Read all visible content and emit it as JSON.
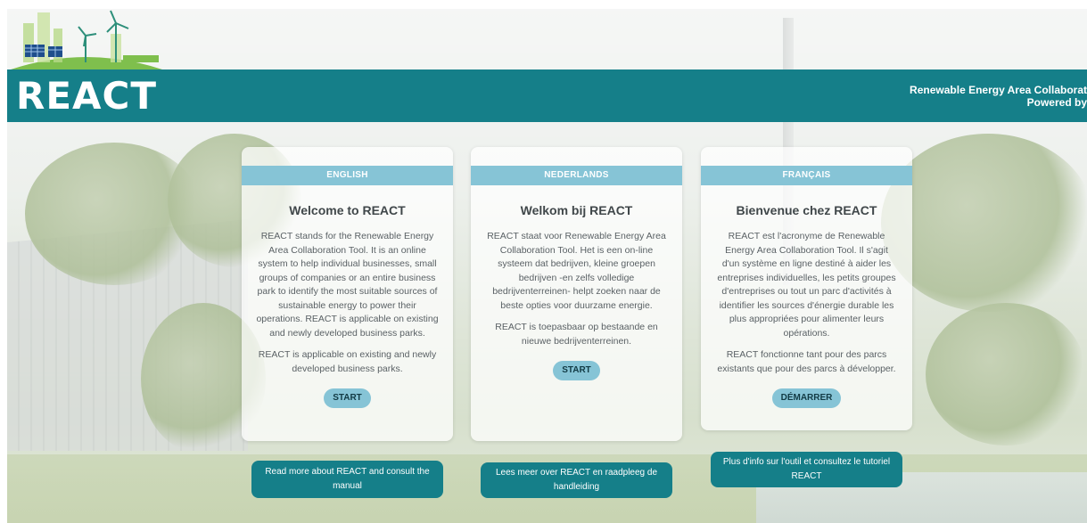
{
  "header": {
    "brand": "REACT",
    "tagline_line1": "Renewable Energy Area Collaborat",
    "tagline_line2": "Powered by"
  },
  "cards": [
    {
      "language": "ENGLISH",
      "title": "Welcome to REACT",
      "paragraphs": [
        "REACT stands for the Renewable Energy Area Collaboration Tool. It is an online system to help individual businesses, small groups of companies or an entire business park to identify the most suitable sources of sustainable energy to power their operations. REACT is applicable on existing and newly developed business parks.",
        "REACT is applicable on existing and newly developed business parks."
      ],
      "button": "START",
      "info_link": "Read more about REACT and consult the manual"
    },
    {
      "language": "NEDERLANDS",
      "title": "Welkom bij REACT",
      "paragraphs": [
        "REACT staat voor Renewable Energy Area Collaboration Tool. Het is een on-line systeem dat bedrijven, kleine groepen bedrijven -en zelfs volledige bedrijventerreinen- helpt zoeken naar de beste opties voor duurzame energie.",
        "REACT is toepasbaar op bestaande en nieuwe bedrijventerreinen."
      ],
      "button": "START",
      "info_link": "Lees meer over REACT en raadpleeg de handleiding"
    },
    {
      "language": "FRANÇAIS",
      "title": "Bienvenue chez REACT",
      "paragraphs": [
        "REACT est l'acronyme de Renewable Energy Area Collaboration Tool. Il s'agit d'un système en ligne destiné à aider les entreprises individuelles, les petits groupes d'entreprises ou tout un parc d'activités à identifier les sources d'énergie durable les plus appropriées pour alimenter leurs opérations.",
        "REACT fonctionne tant pour des parcs existants que pour des parcs à développer."
      ],
      "button": "DÉMARRER",
      "info_link": "Plus d'info sur l'outil et consultez le tutoriel REACT"
    }
  ],
  "colors": {
    "header_teal": "#157f89",
    "card_accent": "#86c4d6"
  }
}
